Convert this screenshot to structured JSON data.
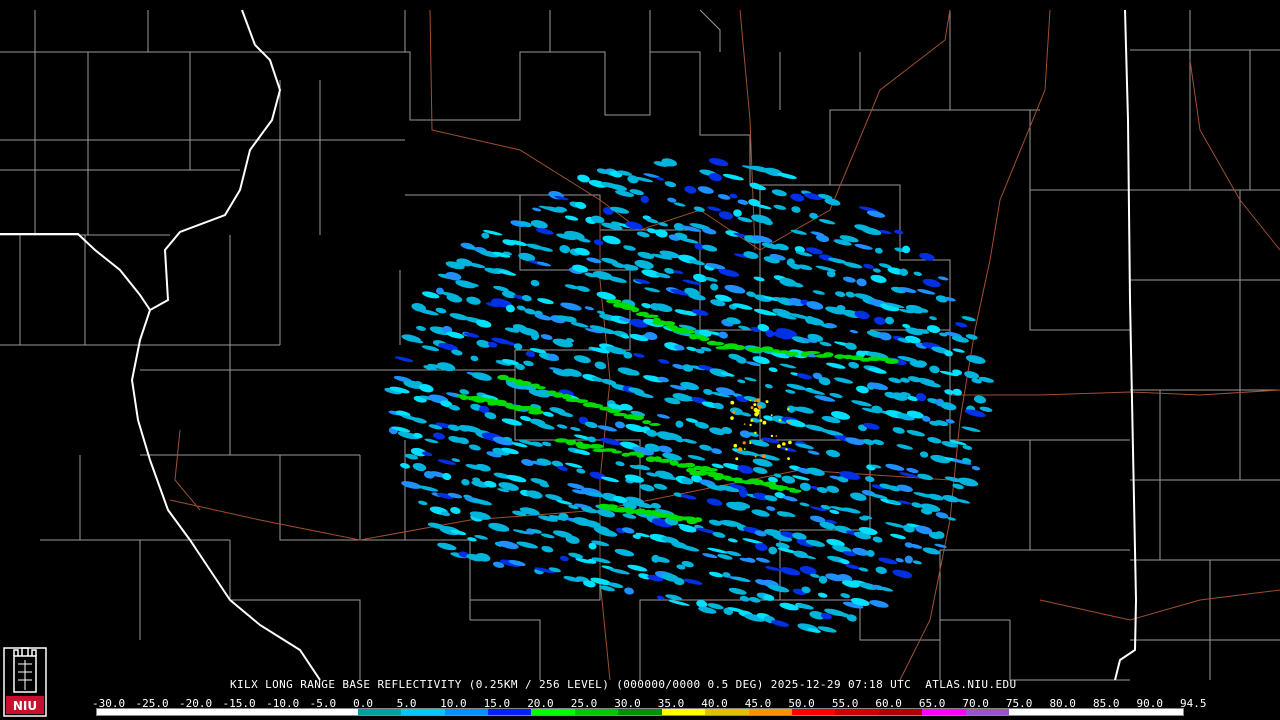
{
  "header": {
    "title": "KILX LONG RANGE BASE REFLECTIVITY (0.25KM / 256 LEVEL) (000000/0000 0.5 DEG) 2025-12-29 07:18 UTC  ATLAS.NIU.EDU"
  },
  "logo": {
    "text": "NIU",
    "icon": "niu-seal-icon",
    "colors": {
      "red": "#c8102e",
      "white": "#ffffff"
    }
  },
  "color_scale": {
    "labels": [
      "-30.0",
      "-25.0",
      "-20.0",
      "-15.0",
      "-10.0",
      "-5.0",
      "0.0",
      "5.0",
      "10.0",
      "15.0",
      "20.0",
      "25.0",
      "30.0",
      "35.0",
      "40.0",
      "45.0",
      "50.0",
      "55.0",
      "60.0",
      "65.0",
      "70.0",
      "75.0",
      "80.0",
      "85.0",
      "90.0",
      "94.5"
    ],
    "colors": [
      "#ffffff",
      "#ffffff",
      "#ffffff",
      "#ffffff",
      "#ffffff",
      "#ffffff",
      "#00a0a0",
      "#00c8ff",
      "#0090ff",
      "#0020ff",
      "#00ff00",
      "#00c800",
      "#009000",
      "#ffff00",
      "#e0c000",
      "#ff9000",
      "#ff0000",
      "#d00000",
      "#b00000",
      "#ff00ff",
      "#9955c8",
      "#ffffff",
      "#ffffff",
      "#ffffff",
      "#ffffff"
    ]
  },
  "map": {
    "colors": {
      "background": "#000000",
      "state_border": "#ffffff",
      "county_border": "#9a9a9a",
      "highway": "#a05030"
    },
    "echo_colors": [
      "#00b4dc",
      "#00e0ff",
      "#1e90ff",
      "#0030e6",
      "#00dc00",
      "#ffff00",
      "#ff9000"
    ],
    "radar_site": "KILX"
  }
}
